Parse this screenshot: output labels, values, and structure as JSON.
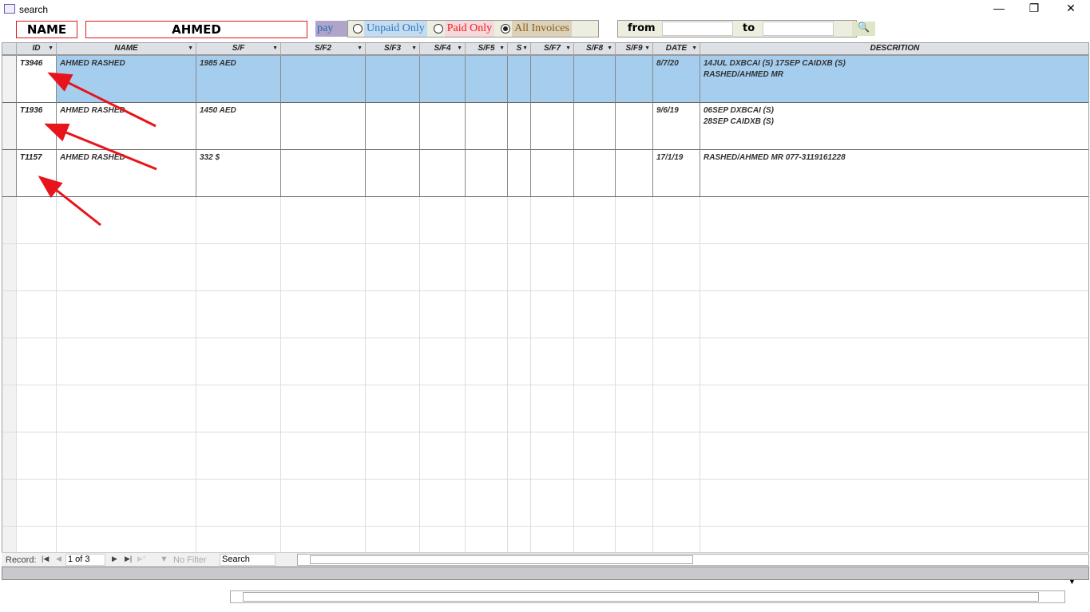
{
  "window": {
    "title": "search",
    "icon": "form-icon",
    "minimize": "—",
    "restore": "❐",
    "close": "✕"
  },
  "search": {
    "name_label": "NAME",
    "name_value": "AHMED",
    "pay_label": "pay",
    "options": [
      {
        "label": "Unpaid Only",
        "color": "#2a7ac4",
        "bg": "#c5dcf0",
        "checked": false
      },
      {
        "label": "Paid Only",
        "color": "#f01c1c",
        "bg": "#f5d9dc",
        "checked": false
      },
      {
        "label": "All Invoices",
        "color": "#8a5a1a",
        "bg": "#dcd2b9",
        "checked": true
      }
    ],
    "from_label": "from",
    "from_value": "",
    "to_label": "to",
    "to_value": "",
    "print_preview_icon": "print-preview-icon"
  },
  "grid": {
    "columns": [
      "ID",
      "NAME",
      "S/F",
      "S/F2",
      "S/F3",
      "S/F4",
      "S/F5",
      "S",
      "S/F7",
      "S/F8",
      "S/F9",
      "DATE",
      "DESCRITION"
    ],
    "rows": [
      {
        "id": "T3946",
        "name": "AHMED RASHED",
        "sf": "1985 AED",
        "date": "8/7/20",
        "description": "14JUL DXBCAI (S) 17SEP CAIDXB (S)\nRASHED/AHMED MR",
        "selected": true
      },
      {
        "id": "T1936",
        "name": "AHMED RASHED",
        "sf": "1450 AED",
        "date": "9/6/19",
        "description": "06SEP DXBCAI (S)\n28SEP CAIDXB (S)",
        "selected": false
      },
      {
        "id": "T1157",
        "name": "AHMED RASHED",
        "sf": "332 $",
        "date": "17/1/19",
        "description": "RASHED/AHMED MR 077-3119161228",
        "selected": false
      }
    ]
  },
  "navigation": {
    "record_label": "Record:",
    "position": "1 of 3",
    "no_filter": "No Filter",
    "search": "Search"
  },
  "colors": {
    "selected_row": "#a5cdee",
    "annotation_arrow": "#e8141c"
  }
}
